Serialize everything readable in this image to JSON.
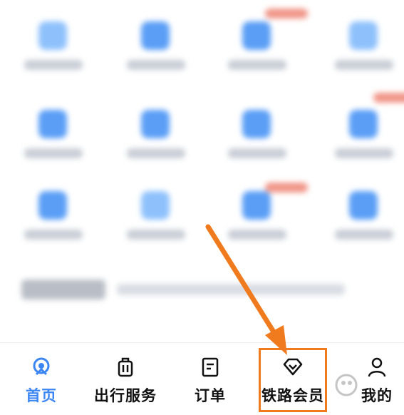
{
  "nav": {
    "items": [
      {
        "label": "首页",
        "icon": "home-icon",
        "active": true
      },
      {
        "label": "出行服务",
        "icon": "luggage-icon",
        "active": false
      },
      {
        "label": "订单",
        "icon": "order-icon",
        "active": false
      },
      {
        "label": "铁路会员",
        "icon": "diamond-icon",
        "active": false
      },
      {
        "label": "我的",
        "icon": "person-icon",
        "active": false
      }
    ]
  },
  "colors": {
    "active": "#3b86f3",
    "text": "#111111",
    "highlight": "#f07a1e"
  }
}
